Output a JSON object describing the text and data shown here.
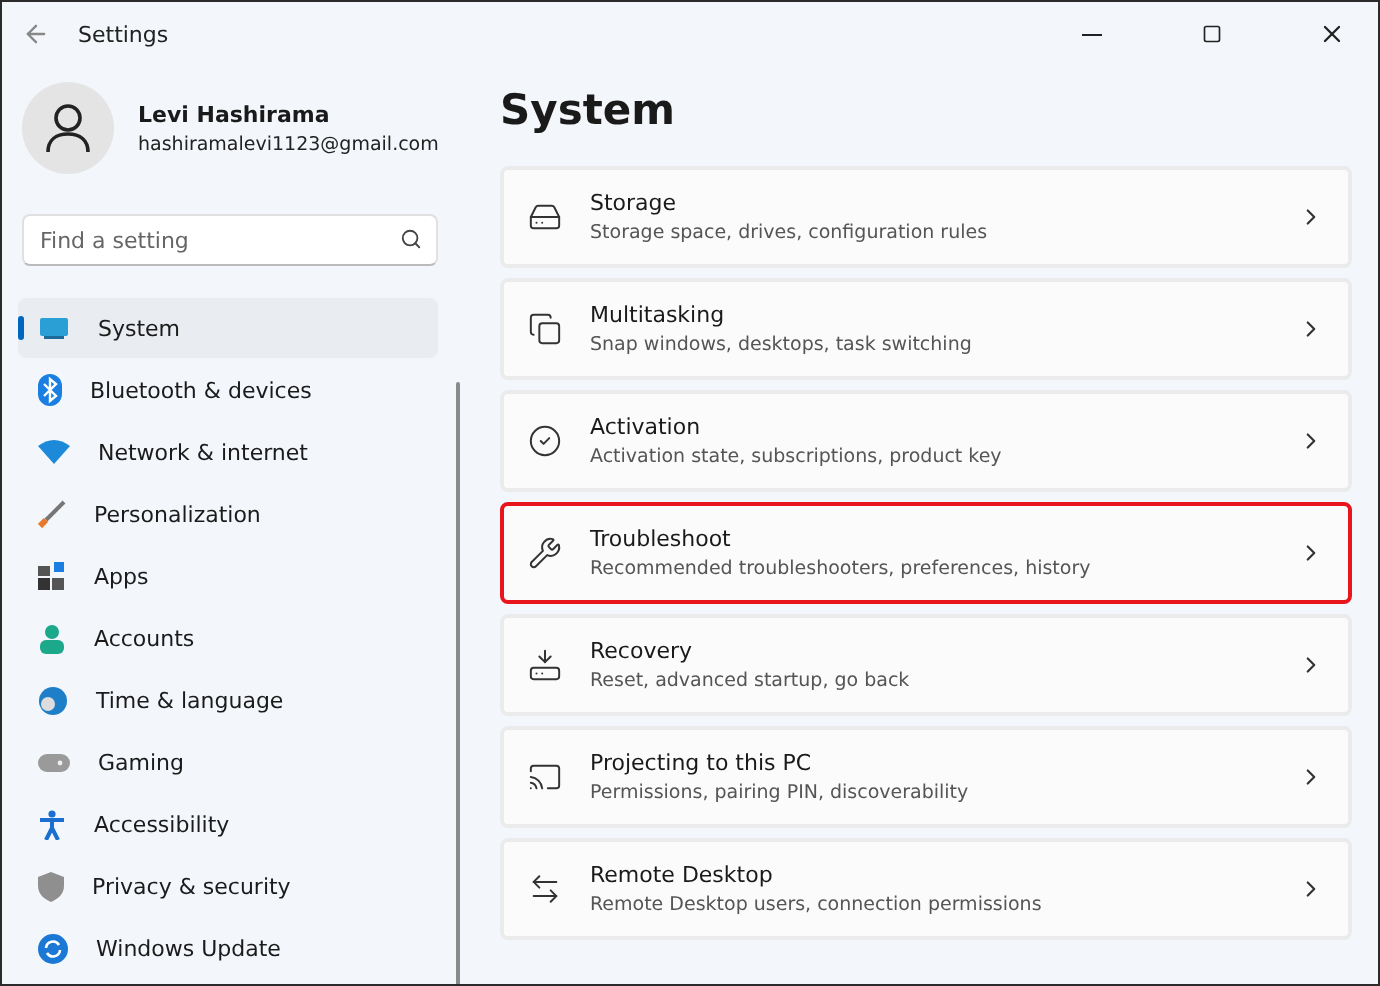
{
  "window": {
    "title": "Settings"
  },
  "account": {
    "name": "Levi Hashirama",
    "email": "hashiramalevi1123@gmail.com"
  },
  "search": {
    "placeholder": "Find a setting"
  },
  "sidebar": {
    "items": [
      {
        "label": "System",
        "selected": true
      },
      {
        "label": "Bluetooth & devices",
        "selected": false
      },
      {
        "label": "Network & internet",
        "selected": false
      },
      {
        "label": "Personalization",
        "selected": false
      },
      {
        "label": "Apps",
        "selected": false
      },
      {
        "label": "Accounts",
        "selected": false
      },
      {
        "label": "Time & language",
        "selected": false
      },
      {
        "label": "Gaming",
        "selected": false
      },
      {
        "label": "Accessibility",
        "selected": false
      },
      {
        "label": "Privacy & security",
        "selected": false
      },
      {
        "label": "Windows Update",
        "selected": false
      }
    ]
  },
  "page": {
    "title": "System"
  },
  "cards": [
    {
      "title": "Storage",
      "subtitle": "Storage space, drives, configuration rules",
      "highlighted": false
    },
    {
      "title": "Multitasking",
      "subtitle": "Snap windows, desktops, task switching",
      "highlighted": false
    },
    {
      "title": "Activation",
      "subtitle": "Activation state, subscriptions, product key",
      "highlighted": false
    },
    {
      "title": "Troubleshoot",
      "subtitle": "Recommended troubleshooters, preferences, history",
      "highlighted": true
    },
    {
      "title": "Recovery",
      "subtitle": "Reset, advanced startup, go back",
      "highlighted": false
    },
    {
      "title": "Projecting to this PC",
      "subtitle": "Permissions, pairing PIN, discoverability",
      "highlighted": false
    },
    {
      "title": "Remote Desktop",
      "subtitle": "Remote Desktop users, connection permissions",
      "highlighted": false
    }
  ]
}
